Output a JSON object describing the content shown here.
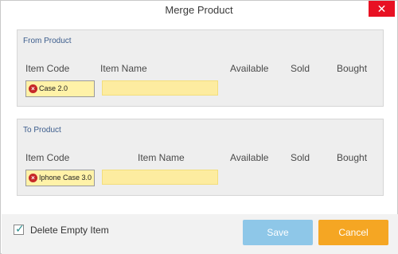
{
  "window": {
    "title": "Merge Product",
    "close_glyph": "✕"
  },
  "from_product": {
    "label": "From Product",
    "columns": [
      "Item Code",
      "Item Name",
      "Available",
      "Sold",
      "Bought"
    ],
    "item_code": "Case 2.0",
    "item_name": ""
  },
  "to_product": {
    "label": "To Product",
    "columns": [
      "Item Code",
      "Item Name",
      "Available",
      "Sold",
      "Bought"
    ],
    "item_code": "Iphone Case 3.0",
    "item_name": ""
  },
  "footer": {
    "delete_empty_item_label": "Delete Empty Item",
    "delete_empty_item_checked": true,
    "save_label": "Save",
    "cancel_label": "Cancel"
  },
  "icons": {
    "clear_icon": "clear-x-icon",
    "check_icon": "check-icon"
  },
  "colors": {
    "close_button": "#e81123",
    "group_label": "#3b5c8c",
    "code_input_bg": "#fff2a8",
    "name_input_bg": "#fdeca0",
    "save_button": "#8ec7e8",
    "cancel_button": "#f5a623",
    "checkbox_mark": "#2a8f8f"
  }
}
